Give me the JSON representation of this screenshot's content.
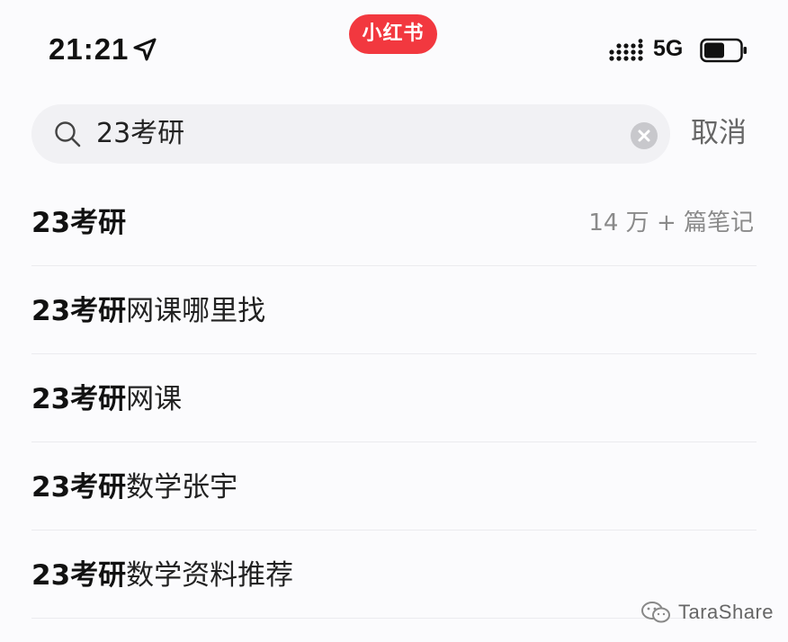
{
  "status_bar": {
    "time": "21:21",
    "network": "5G",
    "icons": [
      "location-arrow-icon",
      "signal-icon",
      "battery-icon"
    ]
  },
  "app_badge": {
    "name": "小红书",
    "color": "#f2383f"
  },
  "search": {
    "query": "23考研",
    "cancel_label": "取消",
    "icons": [
      "search-icon",
      "clear-icon"
    ]
  },
  "suggestions": [
    {
      "highlight": "23考研",
      "rest": "",
      "count": "14 万 + 篇笔记"
    },
    {
      "highlight": "23考研",
      "rest": "网课哪里找"
    },
    {
      "highlight": "23考研",
      "rest": "网课"
    },
    {
      "highlight": "23考研",
      "rest": "数学张宇"
    },
    {
      "highlight": "23考研",
      "rest": "数学资料推荐"
    }
  ],
  "watermark": {
    "text": "TaraShare"
  },
  "colors": {
    "background": "#fbfbfd",
    "search_box": "#f1f1f4",
    "muted_text": "#8a8a8a",
    "brand": "#f2383f"
  }
}
